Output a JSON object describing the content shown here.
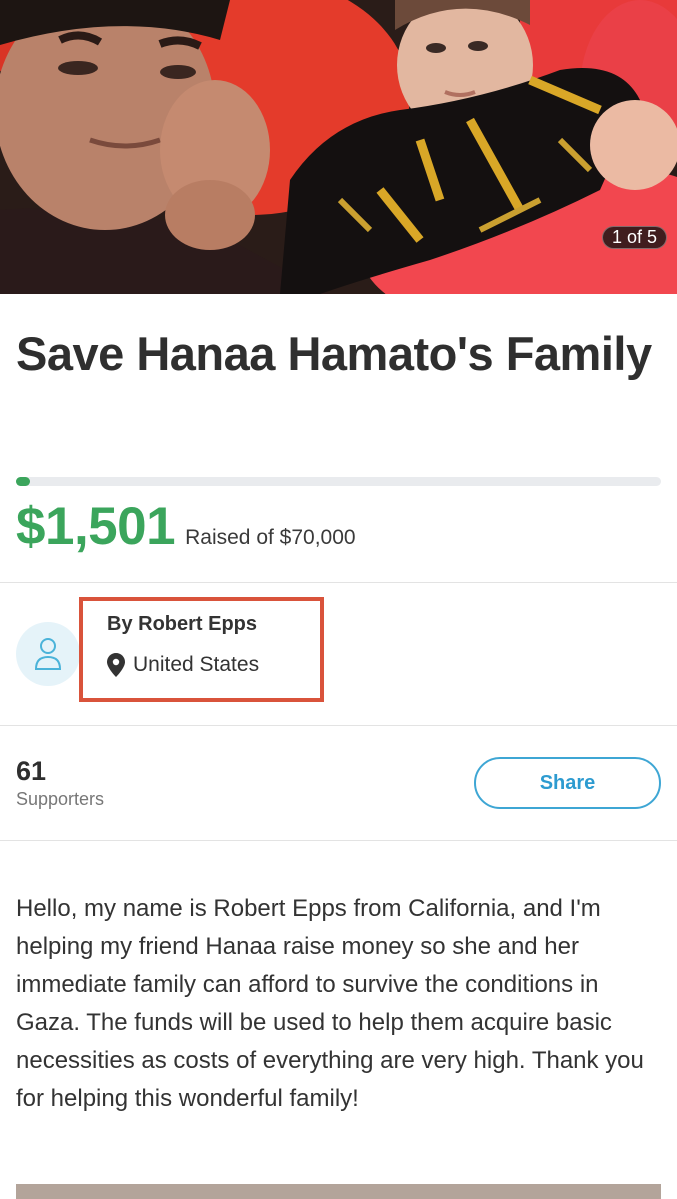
{
  "campaign": {
    "photo": {
      "counter": "1 of 5",
      "current_index": 1,
      "total": 5
    },
    "title": "Save Hanaa Hamato's Family",
    "funding": {
      "raised": "$1,501",
      "raised_label": "Raised of $70,000",
      "progress_fraction": 0.021
    },
    "organizer": {
      "name": "By Robert Epps",
      "location": "United States",
      "avatar_icon": "user-icon",
      "location_icon": "map-pin-icon"
    },
    "supporters": {
      "count": "61",
      "label": "Supporters"
    },
    "share_label": "Share",
    "story": "Hello, my name is Robert Epps from California, and I'm helping my friend Hanaa raise money so she and her immediate family can afford to survive the conditions in Gaza. The funds will be used to help them acquire basic necessities as costs of everything are very high. Thank you for helping this wonderful family!"
  },
  "colors": {
    "accent_green": "#3ba55c",
    "share_blue": "#3ea6d4",
    "highlight_red": "#d9533b",
    "avatar_bg": "#e5f3f9"
  }
}
